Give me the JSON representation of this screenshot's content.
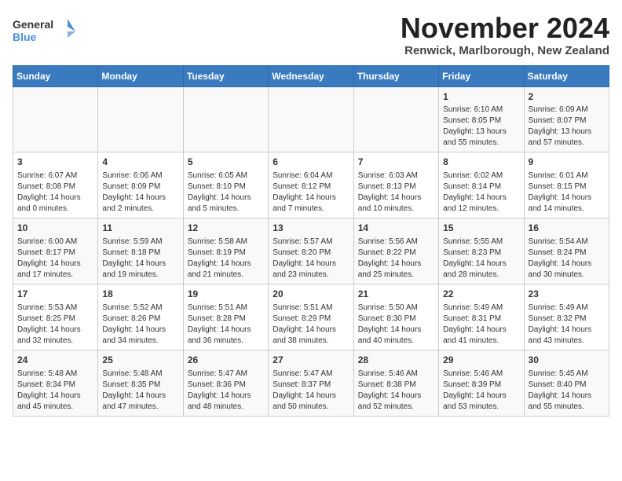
{
  "logo": {
    "line1": "General",
    "line2": "Blue"
  },
  "title": "November 2024",
  "subtitle": "Renwick, Marlborough, New Zealand",
  "weekdays": [
    "Sunday",
    "Monday",
    "Tuesday",
    "Wednesday",
    "Thursday",
    "Friday",
    "Saturday"
  ],
  "weeks": [
    [
      {
        "day": "",
        "info": ""
      },
      {
        "day": "",
        "info": ""
      },
      {
        "day": "",
        "info": ""
      },
      {
        "day": "",
        "info": ""
      },
      {
        "day": "",
        "info": ""
      },
      {
        "day": "1",
        "info": "Sunrise: 6:10 AM\nSunset: 8:05 PM\nDaylight: 13 hours\nand 55 minutes."
      },
      {
        "day": "2",
        "info": "Sunrise: 6:09 AM\nSunset: 8:07 PM\nDaylight: 13 hours\nand 57 minutes."
      }
    ],
    [
      {
        "day": "3",
        "info": "Sunrise: 6:07 AM\nSunset: 8:08 PM\nDaylight: 14 hours\nand 0 minutes."
      },
      {
        "day": "4",
        "info": "Sunrise: 6:06 AM\nSunset: 8:09 PM\nDaylight: 14 hours\nand 2 minutes."
      },
      {
        "day": "5",
        "info": "Sunrise: 6:05 AM\nSunset: 8:10 PM\nDaylight: 14 hours\nand 5 minutes."
      },
      {
        "day": "6",
        "info": "Sunrise: 6:04 AM\nSunset: 8:12 PM\nDaylight: 14 hours\nand 7 minutes."
      },
      {
        "day": "7",
        "info": "Sunrise: 6:03 AM\nSunset: 8:13 PM\nDaylight: 14 hours\nand 10 minutes."
      },
      {
        "day": "8",
        "info": "Sunrise: 6:02 AM\nSunset: 8:14 PM\nDaylight: 14 hours\nand 12 minutes."
      },
      {
        "day": "9",
        "info": "Sunrise: 6:01 AM\nSunset: 8:15 PM\nDaylight: 14 hours\nand 14 minutes."
      }
    ],
    [
      {
        "day": "10",
        "info": "Sunrise: 6:00 AM\nSunset: 8:17 PM\nDaylight: 14 hours\nand 17 minutes."
      },
      {
        "day": "11",
        "info": "Sunrise: 5:59 AM\nSunset: 8:18 PM\nDaylight: 14 hours\nand 19 minutes."
      },
      {
        "day": "12",
        "info": "Sunrise: 5:58 AM\nSunset: 8:19 PM\nDaylight: 14 hours\nand 21 minutes."
      },
      {
        "day": "13",
        "info": "Sunrise: 5:57 AM\nSunset: 8:20 PM\nDaylight: 14 hours\nand 23 minutes."
      },
      {
        "day": "14",
        "info": "Sunrise: 5:56 AM\nSunset: 8:22 PM\nDaylight: 14 hours\nand 25 minutes."
      },
      {
        "day": "15",
        "info": "Sunrise: 5:55 AM\nSunset: 8:23 PM\nDaylight: 14 hours\nand 28 minutes."
      },
      {
        "day": "16",
        "info": "Sunrise: 5:54 AM\nSunset: 8:24 PM\nDaylight: 14 hours\nand 30 minutes."
      }
    ],
    [
      {
        "day": "17",
        "info": "Sunrise: 5:53 AM\nSunset: 8:25 PM\nDaylight: 14 hours\nand 32 minutes."
      },
      {
        "day": "18",
        "info": "Sunrise: 5:52 AM\nSunset: 8:26 PM\nDaylight: 14 hours\nand 34 minutes."
      },
      {
        "day": "19",
        "info": "Sunrise: 5:51 AM\nSunset: 8:28 PM\nDaylight: 14 hours\nand 36 minutes."
      },
      {
        "day": "20",
        "info": "Sunrise: 5:51 AM\nSunset: 8:29 PM\nDaylight: 14 hours\nand 38 minutes."
      },
      {
        "day": "21",
        "info": "Sunrise: 5:50 AM\nSunset: 8:30 PM\nDaylight: 14 hours\nand 40 minutes."
      },
      {
        "day": "22",
        "info": "Sunrise: 5:49 AM\nSunset: 8:31 PM\nDaylight: 14 hours\nand 41 minutes."
      },
      {
        "day": "23",
        "info": "Sunrise: 5:49 AM\nSunset: 8:32 PM\nDaylight: 14 hours\nand 43 minutes."
      }
    ],
    [
      {
        "day": "24",
        "info": "Sunrise: 5:48 AM\nSunset: 8:34 PM\nDaylight: 14 hours\nand 45 minutes."
      },
      {
        "day": "25",
        "info": "Sunrise: 5:48 AM\nSunset: 8:35 PM\nDaylight: 14 hours\nand 47 minutes."
      },
      {
        "day": "26",
        "info": "Sunrise: 5:47 AM\nSunset: 8:36 PM\nDaylight: 14 hours\nand 48 minutes."
      },
      {
        "day": "27",
        "info": "Sunrise: 5:47 AM\nSunset: 8:37 PM\nDaylight: 14 hours\nand 50 minutes."
      },
      {
        "day": "28",
        "info": "Sunrise: 5:46 AM\nSunset: 8:38 PM\nDaylight: 14 hours\nand 52 minutes."
      },
      {
        "day": "29",
        "info": "Sunrise: 5:46 AM\nSunset: 8:39 PM\nDaylight: 14 hours\nand 53 minutes."
      },
      {
        "day": "30",
        "info": "Sunrise: 5:45 AM\nSunset: 8:40 PM\nDaylight: 14 hours\nand 55 minutes."
      }
    ]
  ]
}
